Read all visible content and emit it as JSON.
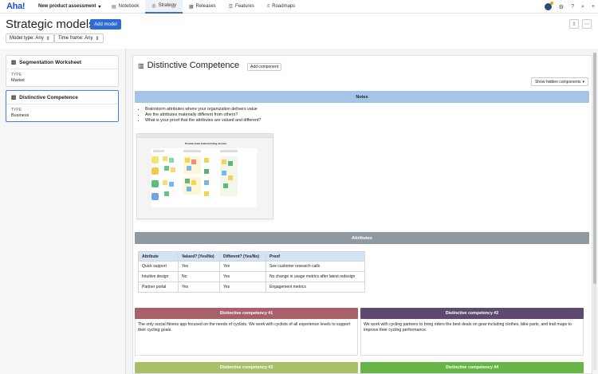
{
  "nav": {
    "logo": "Aha!",
    "workspace": "New product assessment",
    "tabs": [
      {
        "label": "Notebook",
        "icon": "notebook-icon"
      },
      {
        "label": "Strategy",
        "icon": "strategy-icon",
        "active": true
      },
      {
        "label": "Releases",
        "icon": "calendar-icon"
      },
      {
        "label": "Features",
        "icon": "list-icon"
      },
      {
        "label": "Roadmaps",
        "icon": "roadmap-icon"
      }
    ]
  },
  "header": {
    "title": "Strategic models",
    "add_model": "Add model",
    "filters": {
      "model_type": "Model type: Any",
      "time_frame": "Time frame: Any"
    }
  },
  "sidebar": {
    "cards": [
      {
        "title": "Segmentation Worksheet",
        "type_label": "TYPE",
        "type_value": "Market"
      },
      {
        "title": "Distinctive Competence",
        "type_label": "TYPE",
        "type_value": "Business"
      }
    ]
  },
  "doc": {
    "title": "Distinctive Competence",
    "add_component": "Add component",
    "show_hidden": "Show hidden components",
    "notes_title": "Notes",
    "notes": [
      "Brainstorm attributes where your organization delivers value",
      "Are the attributes materially different from others?",
      "What is your proof that the attributes are valued and different?"
    ],
    "board_title": "Product team brainstorming session",
    "attributes_title": "Attributes",
    "table": {
      "headers": [
        "Attribute",
        "Valued? (Yes/No)",
        "Different? (Yes/No)",
        "Proof"
      ],
      "rows": [
        [
          "Quick support",
          "Yes",
          "Yes",
          "See customer research calls"
        ],
        [
          "Intuitive design",
          "No",
          "Yes",
          "No change in usage metrics after latest redesign"
        ],
        [
          "Partner portal",
          "Yes",
          "Yes",
          "Engagement metrics"
        ]
      ]
    },
    "competencies": [
      {
        "title": "Distinctive competency #1",
        "color": "#a8606b",
        "text": "The only social fitness app focused on the needs of cyclists. We work with cyclists of all experience levels to support their cycling goals."
      },
      {
        "title": "Distinctive competency #2",
        "color": "#5e4a6e",
        "text": "We work with cycling partners to bring riders the best deals on gear including clothes, bike parts, and trail maps to improve their cycling performance."
      },
      {
        "title": "Distinctive competency #3",
        "color": "#a9c06a",
        "text": ""
      },
      {
        "title": "Distinctive competency #4",
        "color": "#67b546",
        "text": ""
      }
    ]
  }
}
